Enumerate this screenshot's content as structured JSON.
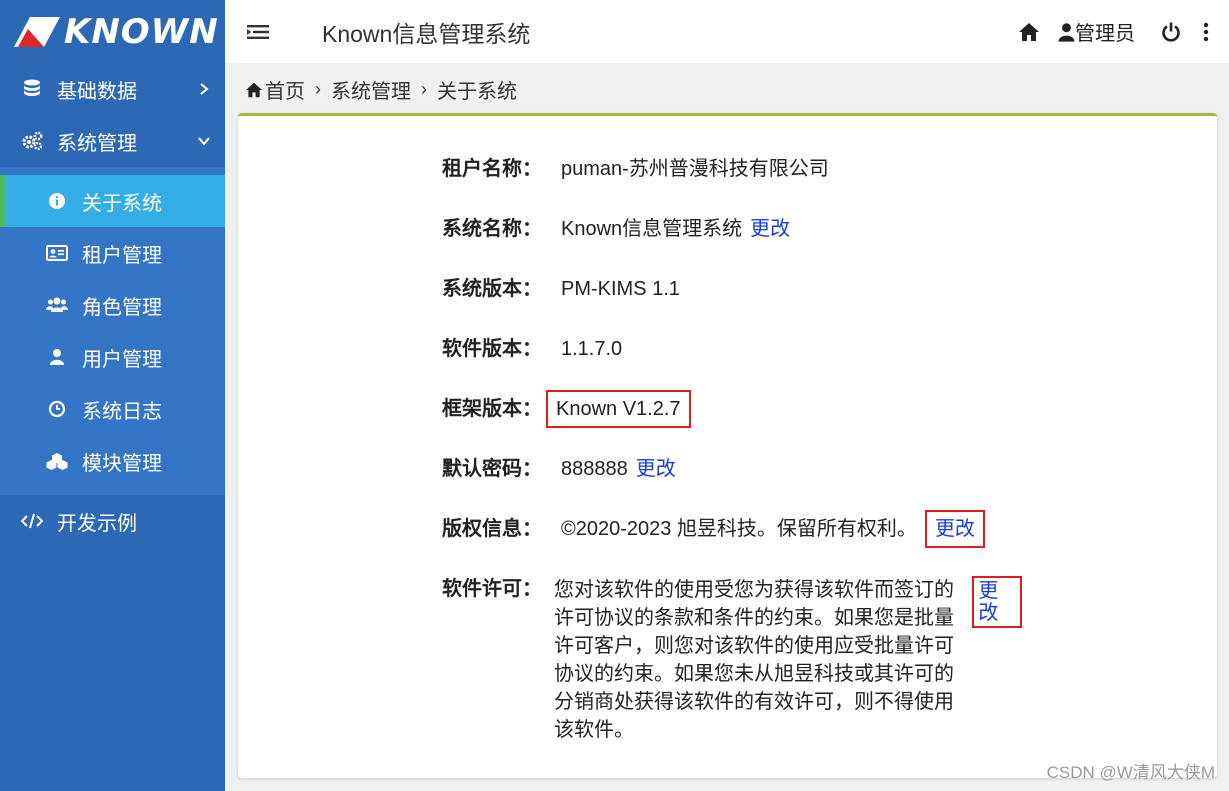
{
  "brand": {
    "logo_text": "KNOWN"
  },
  "header": {
    "title": "Known信息管理系统",
    "user": "管理员"
  },
  "sidebar": {
    "items": [
      {
        "label": "基础数据",
        "icon": "database-icon"
      },
      {
        "label": "系统管理",
        "icon": "gears-icon"
      },
      {
        "label": "开发示例",
        "icon": "code-icon"
      }
    ],
    "submenu": [
      {
        "label": "关于系统",
        "icon": "info-circle-icon",
        "active": true
      },
      {
        "label": "租户管理",
        "icon": "id-card-icon"
      },
      {
        "label": "角色管理",
        "icon": "users-icon"
      },
      {
        "label": "用户管理",
        "icon": "user-icon"
      },
      {
        "label": "系统日志",
        "icon": "clock-icon"
      },
      {
        "label": "模块管理",
        "icon": "cubes-icon"
      }
    ]
  },
  "breadcrumb": [
    "首页",
    "系统管理",
    "关于系统"
  ],
  "info": {
    "tenant_label": "租户名称：",
    "tenant_value": "puman-苏州普漫科技有限公司",
    "sysname_label": "系统名称：",
    "sysname_value": "Known信息管理系统",
    "sysver_label": "系统版本：",
    "sysver_value": "PM-KIMS 1.1",
    "softver_label": "软件版本：",
    "softver_value": "1.1.7.0",
    "framever_label": "框架版本：",
    "framever_value": "Known V1.2.7",
    "pwd_label": "默认密码：",
    "pwd_value": "888888",
    "copyright_label": "版权信息：",
    "copyright_value": "©2020-2023 旭昱科技。保留所有权利。",
    "license_label": "软件许可：",
    "license_value": "您对该软件的使用受您为获得该软件而签订的许可协议的条款和条件的约束。如果您是批量许可客户，则您对该软件的使用应受批量许可协议的约束。如果您未从旭昱科技或其许可的分销商处获得该软件的有效许可，则不得使用该软件。",
    "edit_label": "更改"
  },
  "watermark": "CSDN @W清风大侠M",
  "colors": {
    "sidebar_bg": "#2c68b4",
    "submenu_bg": "#3476c5",
    "active_bg": "#35aee8",
    "card_top_border": "#a9b739",
    "highlight_box": "#e01d1d",
    "link": "#1a3fd1"
  }
}
